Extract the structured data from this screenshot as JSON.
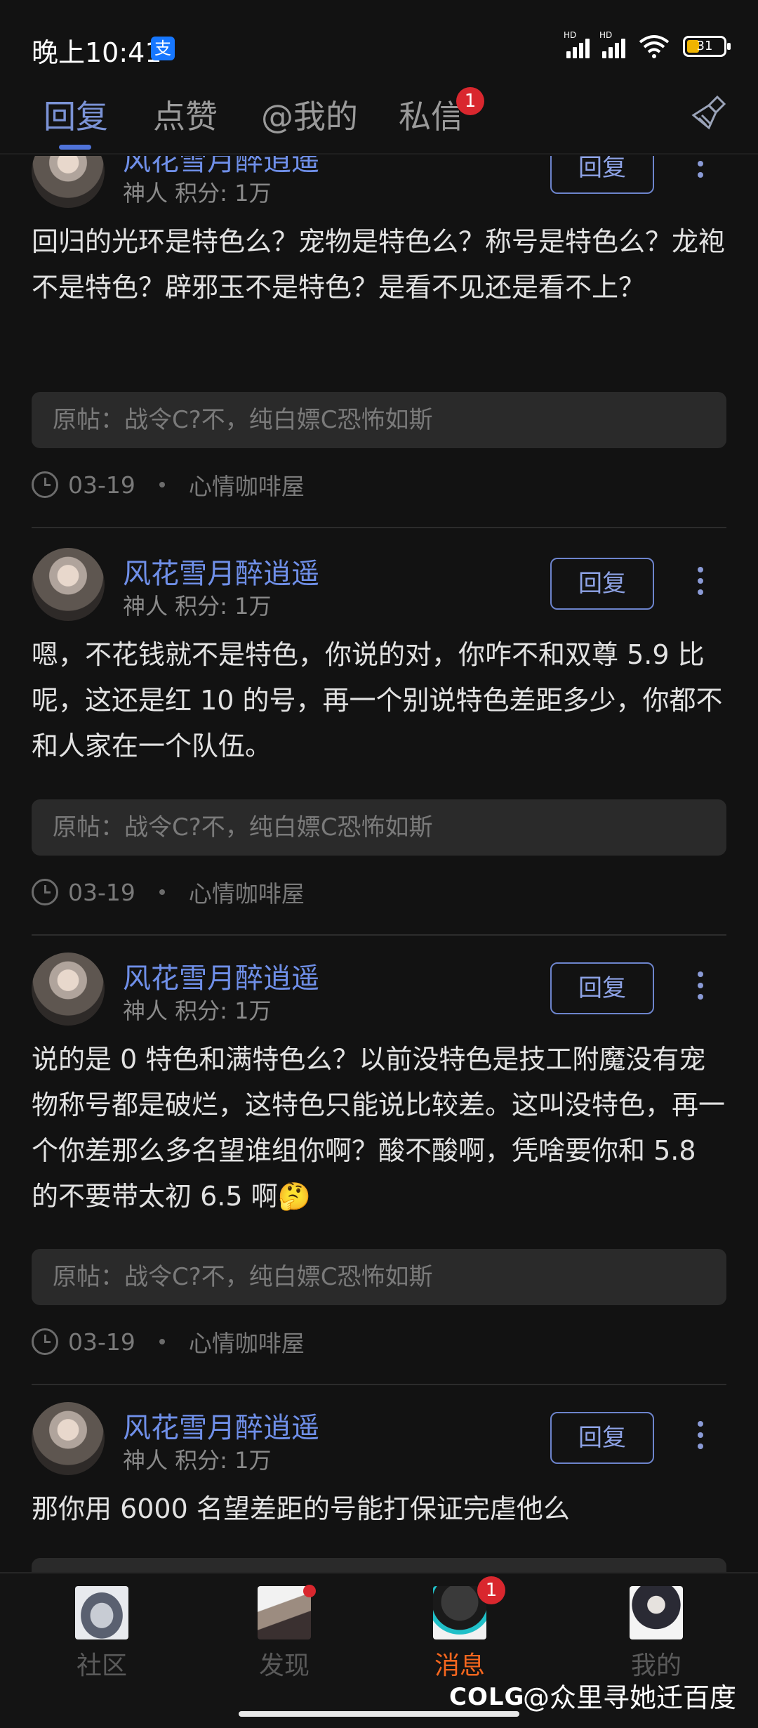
{
  "status_bar": {
    "time": "晚上10:41",
    "alipay_glyph": "支",
    "battery_level": "31",
    "signal_label": "HD"
  },
  "tabs": [
    {
      "label": "回复",
      "active": true
    },
    {
      "label": "点赞",
      "active": false
    },
    {
      "label": "@我的",
      "active": false
    },
    {
      "label": "私信",
      "active": false,
      "badge": "1"
    }
  ],
  "cards": [
    {
      "user": "风花雪月醉逍遥",
      "meta": "神人  积分: 1万",
      "reply_label": "回复",
      "content": "回归的光环是特色么？宠物是特色么？称号是特色么？龙袍不是特色？辟邪玉不是特色？是看不见还是看不上？",
      "origin": "原帖：战令C?不，纯白嫖C恐怖如斯",
      "date": "03-19",
      "board": "心情咖啡屋"
    },
    {
      "user": "风花雪月醉逍遥",
      "meta": "神人  积分: 1万",
      "reply_label": "回复",
      "content": "嗯，不花钱就不是特色，你说的对，你咋不和双尊 5.9 比呢，这还是红 10 的号，再一个别说特色差距多少，你都不和人家在一个队伍。",
      "origin": "原帖：战令C?不，纯白嫖C恐怖如斯",
      "date": "03-19",
      "board": "心情咖啡屋"
    },
    {
      "user": "风花雪月醉逍遥",
      "meta": "神人  积分: 1万",
      "reply_label": "回复",
      "content": "说的是 0 特色和满特色么？以前没特色是技工附魔没有宠物称号都是破烂，这特色只能说比较差。这叫没特色，再一个你差那么多名望谁组你啊？酸不酸啊，凭啥要你和 5.8 的不要带太初 6.5 啊🤔",
      "origin": "原帖：战令C?不，纯白嫖C恐怖如斯",
      "date": "03-19",
      "board": "心情咖啡屋"
    },
    {
      "user": "风花雪月醉逍遥",
      "meta": "神人  积分: 1万",
      "reply_label": "回复",
      "content": "那你用 6000 名望差距的号能打保证完虐他么"
    }
  ],
  "bottom_nav": [
    {
      "label": "社区",
      "icon": "community-icon",
      "active": false
    },
    {
      "label": "发现",
      "icon": "discover-icon",
      "active": false,
      "dot": true
    },
    {
      "label": "消息",
      "icon": "message-icon",
      "active": true,
      "badge": "1"
    },
    {
      "label": "我的",
      "icon": "profile-icon",
      "active": false
    }
  ],
  "watermark": {
    "logo": "COLG",
    "text": "@众里寻她迁百度"
  },
  "colors": {
    "background": "#121212",
    "accent": "#6f8fe8",
    "active_nav": "#f5661e",
    "badge": "#d9272e"
  }
}
